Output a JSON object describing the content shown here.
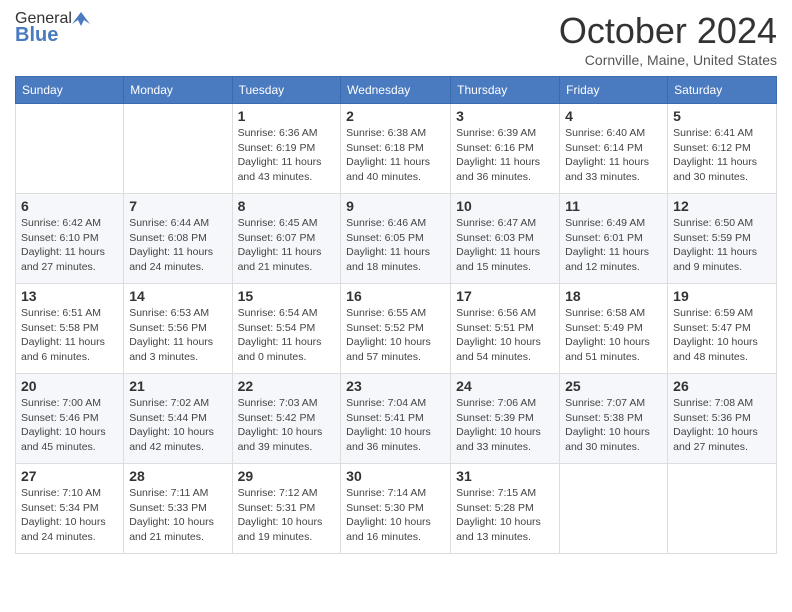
{
  "header": {
    "logo_general": "General",
    "logo_blue": "Blue",
    "title": "October 2024",
    "subtitle": "Cornville, Maine, United States"
  },
  "days_of_week": [
    "Sunday",
    "Monday",
    "Tuesday",
    "Wednesday",
    "Thursday",
    "Friday",
    "Saturday"
  ],
  "weeks": [
    [
      {
        "day": "",
        "info": ""
      },
      {
        "day": "",
        "info": ""
      },
      {
        "day": "1",
        "info": "Sunrise: 6:36 AM\nSunset: 6:19 PM\nDaylight: 11 hours and 43 minutes."
      },
      {
        "day": "2",
        "info": "Sunrise: 6:38 AM\nSunset: 6:18 PM\nDaylight: 11 hours and 40 minutes."
      },
      {
        "day": "3",
        "info": "Sunrise: 6:39 AM\nSunset: 6:16 PM\nDaylight: 11 hours and 36 minutes."
      },
      {
        "day": "4",
        "info": "Sunrise: 6:40 AM\nSunset: 6:14 PM\nDaylight: 11 hours and 33 minutes."
      },
      {
        "day": "5",
        "info": "Sunrise: 6:41 AM\nSunset: 6:12 PM\nDaylight: 11 hours and 30 minutes."
      }
    ],
    [
      {
        "day": "6",
        "info": "Sunrise: 6:42 AM\nSunset: 6:10 PM\nDaylight: 11 hours and 27 minutes."
      },
      {
        "day": "7",
        "info": "Sunrise: 6:44 AM\nSunset: 6:08 PM\nDaylight: 11 hours and 24 minutes."
      },
      {
        "day": "8",
        "info": "Sunrise: 6:45 AM\nSunset: 6:07 PM\nDaylight: 11 hours and 21 minutes."
      },
      {
        "day": "9",
        "info": "Sunrise: 6:46 AM\nSunset: 6:05 PM\nDaylight: 11 hours and 18 minutes."
      },
      {
        "day": "10",
        "info": "Sunrise: 6:47 AM\nSunset: 6:03 PM\nDaylight: 11 hours and 15 minutes."
      },
      {
        "day": "11",
        "info": "Sunrise: 6:49 AM\nSunset: 6:01 PM\nDaylight: 11 hours and 12 minutes."
      },
      {
        "day": "12",
        "info": "Sunrise: 6:50 AM\nSunset: 5:59 PM\nDaylight: 11 hours and 9 minutes."
      }
    ],
    [
      {
        "day": "13",
        "info": "Sunrise: 6:51 AM\nSunset: 5:58 PM\nDaylight: 11 hours and 6 minutes."
      },
      {
        "day": "14",
        "info": "Sunrise: 6:53 AM\nSunset: 5:56 PM\nDaylight: 11 hours and 3 minutes."
      },
      {
        "day": "15",
        "info": "Sunrise: 6:54 AM\nSunset: 5:54 PM\nDaylight: 11 hours and 0 minutes."
      },
      {
        "day": "16",
        "info": "Sunrise: 6:55 AM\nSunset: 5:52 PM\nDaylight: 10 hours and 57 minutes."
      },
      {
        "day": "17",
        "info": "Sunrise: 6:56 AM\nSunset: 5:51 PM\nDaylight: 10 hours and 54 minutes."
      },
      {
        "day": "18",
        "info": "Sunrise: 6:58 AM\nSunset: 5:49 PM\nDaylight: 10 hours and 51 minutes."
      },
      {
        "day": "19",
        "info": "Sunrise: 6:59 AM\nSunset: 5:47 PM\nDaylight: 10 hours and 48 minutes."
      }
    ],
    [
      {
        "day": "20",
        "info": "Sunrise: 7:00 AM\nSunset: 5:46 PM\nDaylight: 10 hours and 45 minutes."
      },
      {
        "day": "21",
        "info": "Sunrise: 7:02 AM\nSunset: 5:44 PM\nDaylight: 10 hours and 42 minutes."
      },
      {
        "day": "22",
        "info": "Sunrise: 7:03 AM\nSunset: 5:42 PM\nDaylight: 10 hours and 39 minutes."
      },
      {
        "day": "23",
        "info": "Sunrise: 7:04 AM\nSunset: 5:41 PM\nDaylight: 10 hours and 36 minutes."
      },
      {
        "day": "24",
        "info": "Sunrise: 7:06 AM\nSunset: 5:39 PM\nDaylight: 10 hours and 33 minutes."
      },
      {
        "day": "25",
        "info": "Sunrise: 7:07 AM\nSunset: 5:38 PM\nDaylight: 10 hours and 30 minutes."
      },
      {
        "day": "26",
        "info": "Sunrise: 7:08 AM\nSunset: 5:36 PM\nDaylight: 10 hours and 27 minutes."
      }
    ],
    [
      {
        "day": "27",
        "info": "Sunrise: 7:10 AM\nSunset: 5:34 PM\nDaylight: 10 hours and 24 minutes."
      },
      {
        "day": "28",
        "info": "Sunrise: 7:11 AM\nSunset: 5:33 PM\nDaylight: 10 hours and 21 minutes."
      },
      {
        "day": "29",
        "info": "Sunrise: 7:12 AM\nSunset: 5:31 PM\nDaylight: 10 hours and 19 minutes."
      },
      {
        "day": "30",
        "info": "Sunrise: 7:14 AM\nSunset: 5:30 PM\nDaylight: 10 hours and 16 minutes."
      },
      {
        "day": "31",
        "info": "Sunrise: 7:15 AM\nSunset: 5:28 PM\nDaylight: 10 hours and 13 minutes."
      },
      {
        "day": "",
        "info": ""
      },
      {
        "day": "",
        "info": ""
      }
    ]
  ]
}
